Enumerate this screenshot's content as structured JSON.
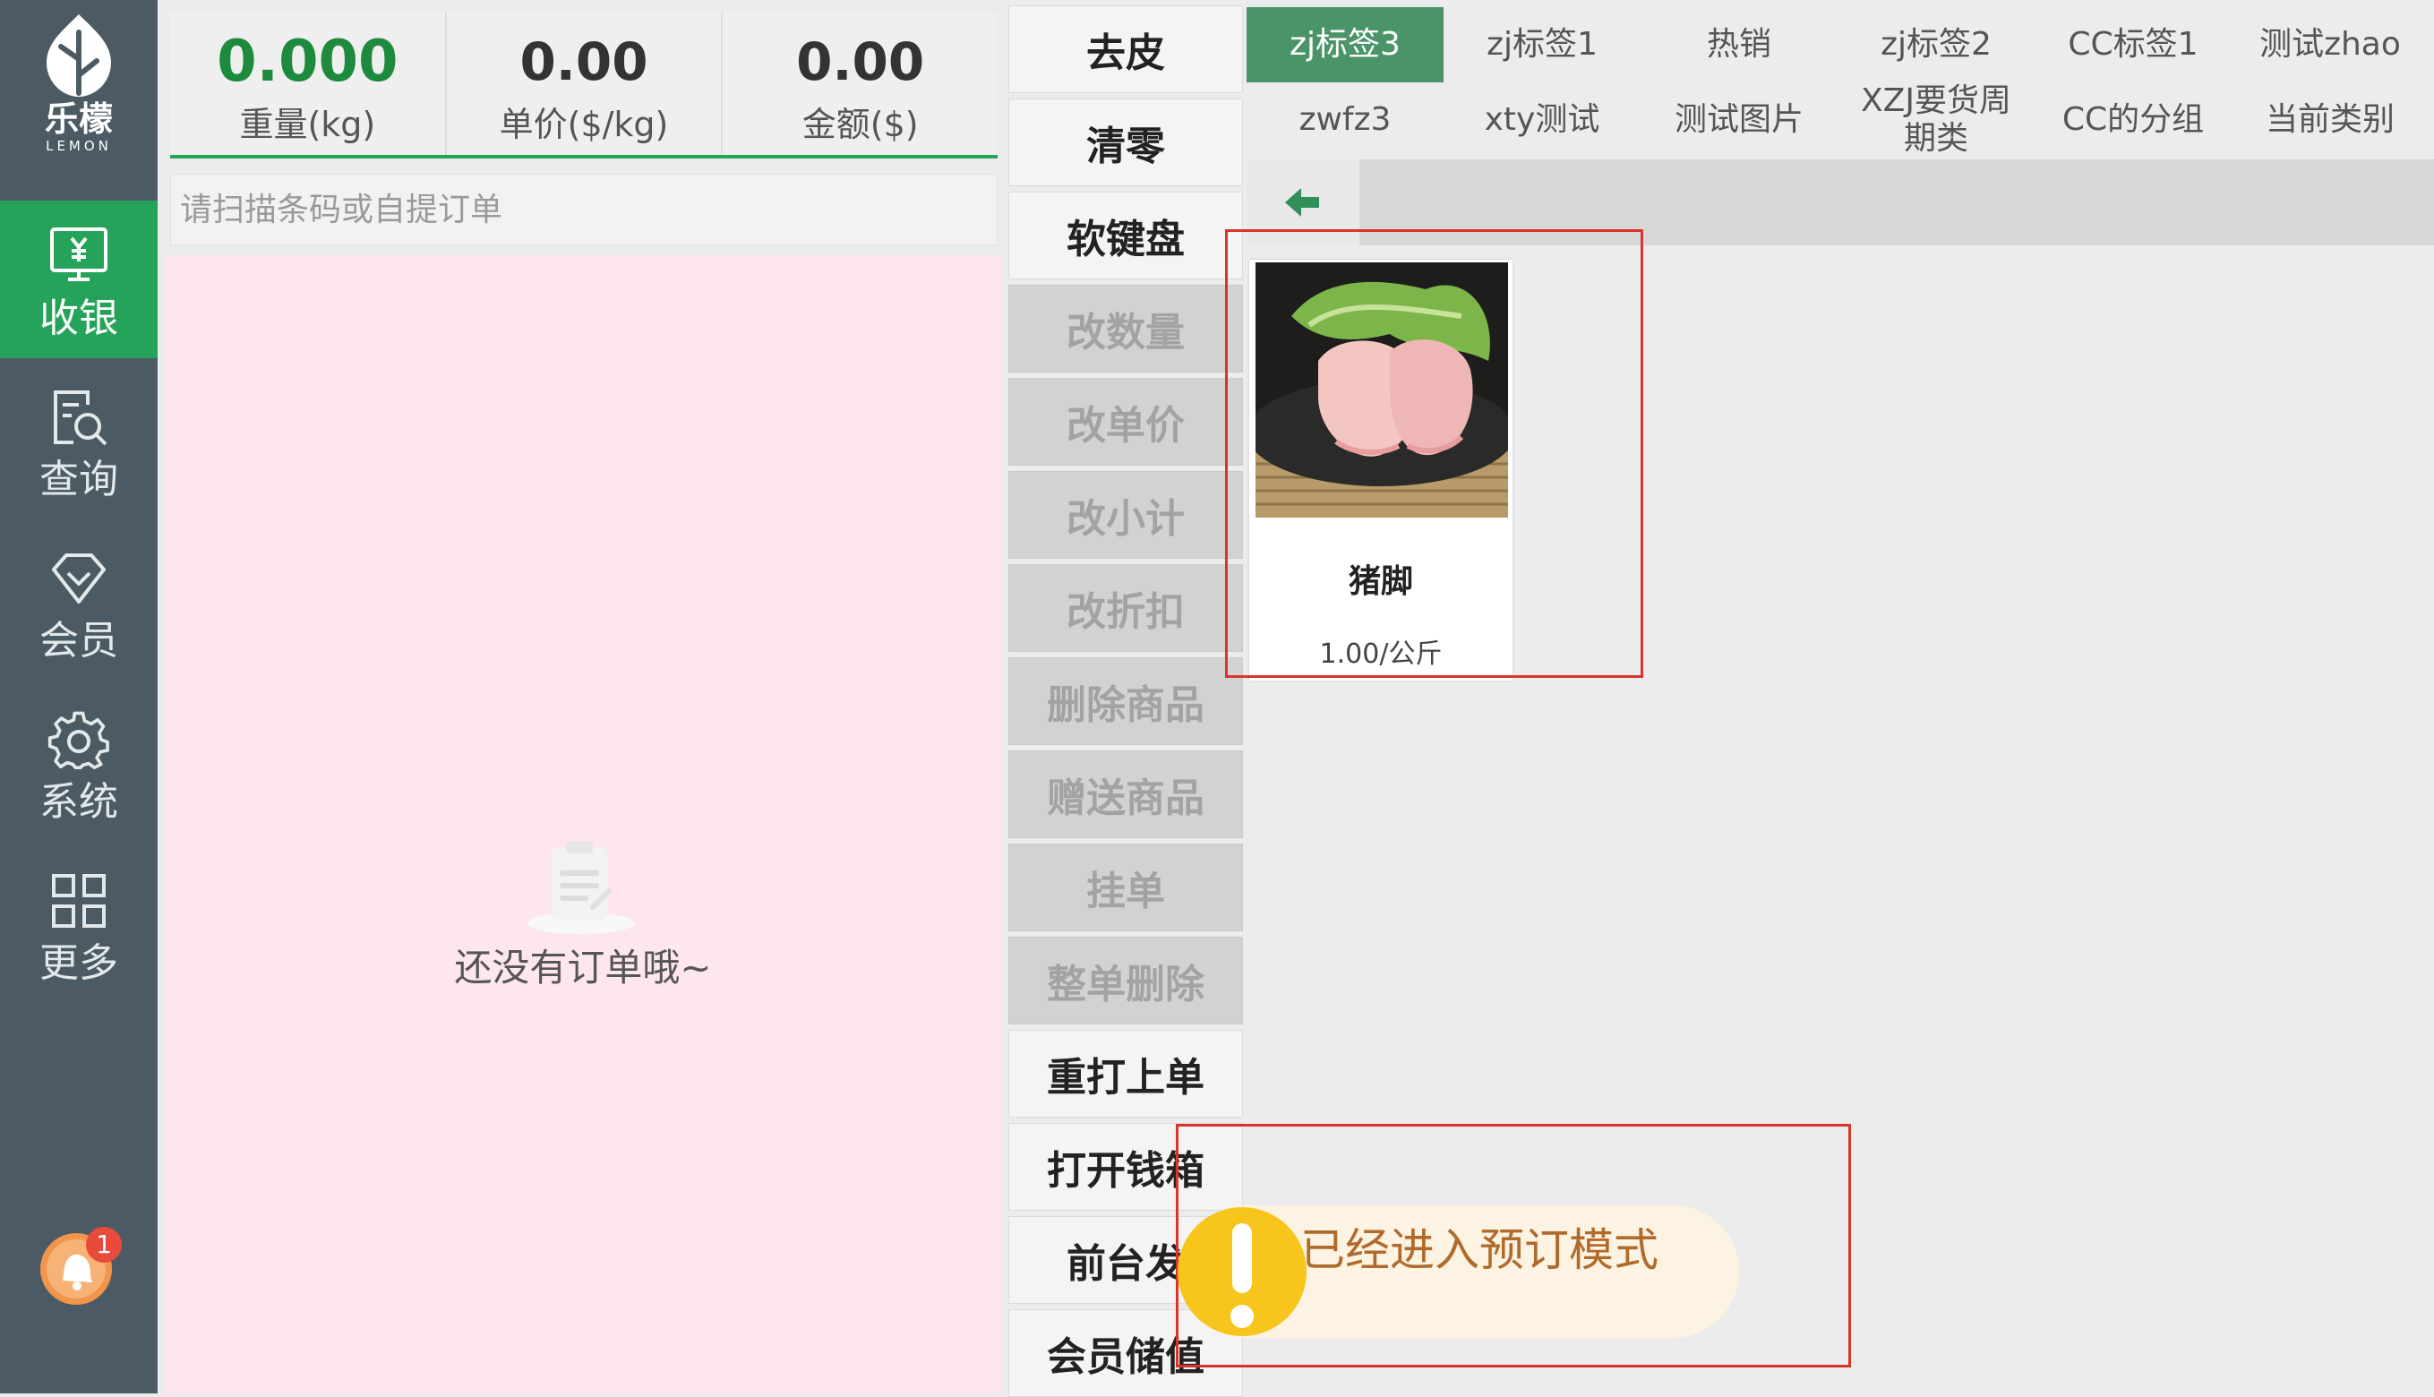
{
  "sidebar": {
    "brand": "乐檬",
    "brand_sub": "LEMON",
    "nav": [
      {
        "label": "收银",
        "icon": "cashier-monitor-icon",
        "active": true
      },
      {
        "label": "查询",
        "icon": "document-search-icon",
        "active": false
      },
      {
        "label": "会员",
        "icon": "diamond-icon",
        "active": false
      },
      {
        "label": "系统",
        "icon": "gear-icon",
        "active": false
      },
      {
        "label": "更多",
        "icon": "grid-icon",
        "active": false
      }
    ],
    "notification_count": "1"
  },
  "scale": {
    "weight": {
      "value": "0.000",
      "label": "重量(kg)"
    },
    "unit_price": {
      "value": "0.00",
      "label": "单价($/kg)"
    },
    "amount": {
      "value": "0.00",
      "label": "金额($)"
    }
  },
  "scan": {
    "placeholder": "请扫描条码或自提订单",
    "value": ""
  },
  "order": {
    "empty_text": "还没有订单哦~"
  },
  "functions": [
    {
      "label": "去皮",
      "enabled": true
    },
    {
      "label": "清零",
      "enabled": true
    },
    {
      "label": "软键盘",
      "enabled": true
    },
    {
      "label": "改数量",
      "enabled": false
    },
    {
      "label": "改单价",
      "enabled": false
    },
    {
      "label": "改小计",
      "enabled": false
    },
    {
      "label": "改折扣",
      "enabled": false
    },
    {
      "label": "删除商品",
      "enabled": false
    },
    {
      "label": "赠送商品",
      "enabled": false
    },
    {
      "label": "挂单",
      "enabled": false
    },
    {
      "label": "整单删除",
      "enabled": false
    },
    {
      "label": "重打上单",
      "enabled": true
    },
    {
      "label": "打开钱箱",
      "enabled": true
    },
    {
      "label": "前台发",
      "enabled": true
    },
    {
      "label": "会员储值",
      "enabled": true
    }
  ],
  "categories": [
    {
      "label": "zj标签3",
      "active": true
    },
    {
      "label": "zj标签1",
      "active": false
    },
    {
      "label": "热销",
      "active": false
    },
    {
      "label": "zj标签2",
      "active": false
    },
    {
      "label": "CC标签1",
      "active": false
    },
    {
      "label": "测试zhao",
      "active": false
    },
    {
      "label": "zwfz3",
      "active": false
    },
    {
      "label": "xty测试",
      "active": false
    },
    {
      "label": "测试图片",
      "active": false
    },
    {
      "label": "XZJ要货周期类",
      "active": false
    },
    {
      "label": "CC的分组",
      "active": false
    },
    {
      "label": "当前类别",
      "active": false
    }
  ],
  "product": {
    "name": "猪脚",
    "price": "1.00/公斤",
    "image": "pig-trotter-photo"
  },
  "toast": {
    "text": "已经进入预订模式",
    "icon": "exclamation-icon"
  },
  "colors": {
    "sidebar": "#4c5b63",
    "accent_green": "#25a35a",
    "tab_active": "#4a9468",
    "order_bg": "#fde6ef",
    "toast_bg": "#fdf3e2",
    "toast_text": "#b06b2c",
    "warning_yellow": "#f7c51b",
    "highlight_red": "#d9342b"
  }
}
